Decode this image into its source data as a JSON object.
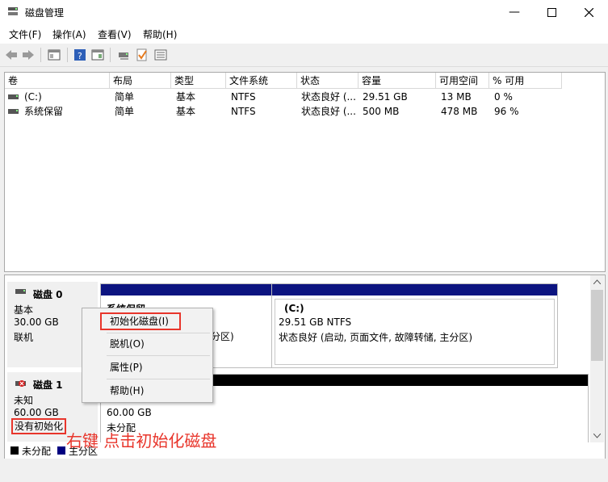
{
  "window": {
    "title": "磁盘管理",
    "minimize_icon": "minimize-icon",
    "maximize_icon": "maximize-icon",
    "close_icon": "close-icon"
  },
  "menu": [
    "文件(F)",
    "操作(A)",
    "查看(V)",
    "帮助(H)"
  ],
  "volume_table": {
    "columns": [
      "卷",
      "布局",
      "类型",
      "文件系统",
      "状态",
      "容量",
      "可用空间",
      "% 可用"
    ],
    "rows": [
      {
        "volume": "(C:)",
        "layout": "简单",
        "type": "基本",
        "fs": "NTFS",
        "status": "状态良好 (...",
        "capacity": "29.51 GB",
        "free": "13 MB",
        "pct": "0 %"
      },
      {
        "volume": "系统保留",
        "layout": "简单",
        "type": "基本",
        "fs": "NTFS",
        "status": "状态良好 (...",
        "capacity": "500 MB",
        "free": "478 MB",
        "pct": "96 %"
      }
    ]
  },
  "disks": [
    {
      "name": "磁盘 0",
      "type": "基本",
      "size": "30.00 GB",
      "state": "联机",
      "partitions": [
        {
          "title": "系统保留",
          "detail": "",
          "status_tail": "分区)"
        },
        {
          "title": "(C:)",
          "detail": "29.51 GB NTFS",
          "status": "状态良好 (启动, 页面文件, 故障转储, 主分区)"
        }
      ]
    },
    {
      "name": "磁盘 1",
      "type": "未知",
      "size": "60.00 GB",
      "state": "没有初始化",
      "partitions": [
        {
          "size": "60.00 GB",
          "status": "未分配"
        }
      ]
    }
  ],
  "legend": [
    {
      "label": "未分配",
      "color": "#000000"
    },
    {
      "label": "主分区",
      "color": "#000080"
    }
  ],
  "context_menu": [
    "初始化磁盘(I)",
    "脱机(O)",
    "属性(P)",
    "帮助(H)"
  ],
  "annotation": "右键 点击初始化磁盘",
  "colors": {
    "partition_header": "#0c1480",
    "unallocated": "#000000",
    "highlight": "#e8352b"
  }
}
